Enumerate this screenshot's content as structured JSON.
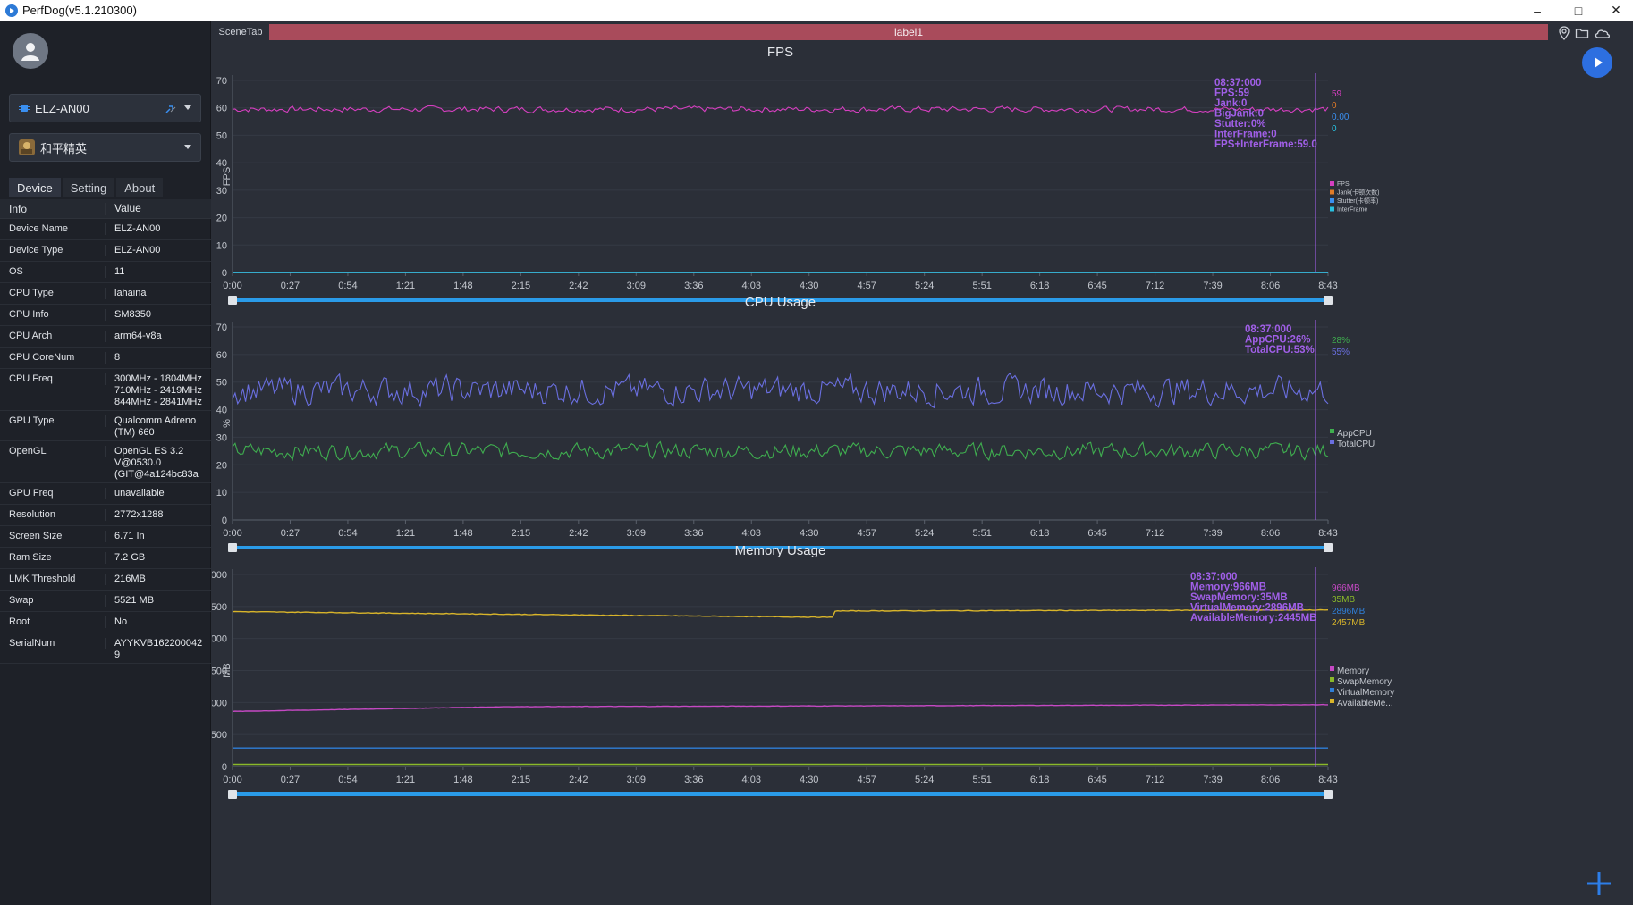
{
  "window": {
    "title": "PerfDog(v5.1.210300)"
  },
  "sidebar": {
    "device_selector": "ELZ-AN00",
    "app_selector": "和平精英",
    "tabs": [
      "Device",
      "Setting",
      "About"
    ],
    "table_headers": {
      "info": "Info",
      "value": "Value"
    },
    "rows": [
      {
        "k": "Device Name",
        "v": "ELZ-AN00"
      },
      {
        "k": "Device Type",
        "v": "ELZ-AN00"
      },
      {
        "k": "OS",
        "v": "11"
      },
      {
        "k": "CPU Type",
        "v": "lahaina"
      },
      {
        "k": "CPU Info",
        "v": "SM8350"
      },
      {
        "k": "CPU Arch",
        "v": "arm64-v8a"
      },
      {
        "k": "CPU CoreNum",
        "v": "8"
      },
      {
        "k": "CPU Freq",
        "v": "300MHz - 1804MHz\n710MHz - 2419MHz\n844MHz - 2841MHz"
      },
      {
        "k": "GPU Type",
        "v": "Qualcomm Adreno\n(TM) 660"
      },
      {
        "k": "OpenGL",
        "v": "OpenGL ES 3.2\nV@0530.0\n(GIT@4a124bc83a"
      },
      {
        "k": "GPU Freq",
        "v": "unavailable"
      },
      {
        "k": "Resolution",
        "v": "2772x1288"
      },
      {
        "k": "Screen Size",
        "v": "6.71 In"
      },
      {
        "k": "Ram Size",
        "v": "7.2 GB"
      },
      {
        "k": "LMK Threshold",
        "v": "216MB"
      },
      {
        "k": "Swap",
        "v": "5521 MB"
      },
      {
        "k": "Root",
        "v": "No"
      },
      {
        "k": "SerialNum",
        "v": "AYYKVB162200042\n9"
      }
    ]
  },
  "scene": {
    "tab": "SceneTab",
    "label": "label1"
  },
  "colors": {
    "fps": "#d63fc0",
    "jank": "#e07b28",
    "stutter": "#3a8ff0",
    "interframe": "#28c0e0",
    "appcpu": "#3fae4f",
    "totalcpu": "#6a6fe0",
    "memory": "#c649c4",
    "swap": "#8ab82a",
    "virtual": "#2f7fd8",
    "available": "#d9b52a",
    "cursor": "#a15fe8",
    "annotation": "#a15fe8",
    "slider": "#2a9be8"
  },
  "chart_data": [
    {
      "type": "line",
      "title": "FPS",
      "ylabel": "FPS",
      "ylim": [
        0,
        70
      ],
      "yticks": [
        "0",
        "10",
        "20",
        "30",
        "40",
        "50",
        "60",
        "70"
      ],
      "xticks": [
        "0:00",
        "0:27",
        "0:54",
        "1:21",
        "1:48",
        "2:15",
        "2:42",
        "3:09",
        "3:36",
        "4:03",
        "4:30",
        "4:57",
        "5:24",
        "5:51",
        "6:18",
        "6:45",
        "7:12",
        "7:39",
        "8:06",
        "8:43"
      ],
      "duration_s": 523,
      "cursor_s": 517,
      "series": [
        {
          "name": "FPS",
          "kind": "noise",
          "base": 59.5,
          "amp": 1.5,
          "color_key": "fps"
        },
        {
          "name": "Jank(卡顿次数)",
          "kind": "flat",
          "base": 0,
          "color_key": "jank"
        },
        {
          "name": "Stutter(卡顿率)",
          "kind": "flat",
          "base": 0,
          "color_key": "stutter"
        },
        {
          "name": "InterFrame",
          "kind": "flat",
          "base": 0,
          "color_key": "interframe"
        }
      ],
      "annotation": [
        "08:37:000",
        "FPS:59",
        "Jank:0",
        "BigJank:0",
        "Stutter:0%",
        "InterFrame:0",
        "FPS+InterFrame:59.0"
      ],
      "right_values": [
        "59",
        "0",
        "0.00",
        "0"
      ]
    },
    {
      "type": "line",
      "title": "CPU Usage",
      "ylabel": "%",
      "ylim": [
        0,
        70
      ],
      "yticks": [
        "0",
        "10",
        "20",
        "30",
        "40",
        "50",
        "60",
        "70"
      ],
      "xticks": [
        "0:00",
        "0:27",
        "0:54",
        "1:21",
        "1:48",
        "2:15",
        "2:42",
        "3:09",
        "3:36",
        "4:03",
        "4:30",
        "4:57",
        "5:24",
        "5:51",
        "6:18",
        "6:45",
        "7:12",
        "7:39",
        "8:06",
        "8:43"
      ],
      "duration_s": 523,
      "cursor_s": 517,
      "series": [
        {
          "name": "AppCPU",
          "kind": "noise",
          "base": 25,
          "amp": 4,
          "color_key": "appcpu"
        },
        {
          "name": "TotalCPU",
          "kind": "noise",
          "base": 47,
          "amp": 7,
          "color_key": "totalcpu"
        }
      ],
      "annotation": [
        "08:37:000",
        "AppCPU:26%",
        "TotalCPU:53%"
      ],
      "right_values": [
        "28%",
        "55%"
      ]
    },
    {
      "type": "line",
      "title": "Memory Usage",
      "ylabel": "MB",
      "ylim": [
        0,
        3000
      ],
      "yticks": [
        "0",
        "500",
        "1,000",
        "1,500",
        "2,000",
        "2,500",
        "3,000"
      ],
      "xticks": [
        "0:00",
        "0:27",
        "0:54",
        "1:21",
        "1:48",
        "2:15",
        "2:42",
        "3:09",
        "3:36",
        "4:03",
        "4:30",
        "4:57",
        "5:24",
        "5:51",
        "6:18",
        "6:45",
        "7:12",
        "7:39",
        "8:06",
        "8:43"
      ],
      "duration_s": 523,
      "cursor_s": 517,
      "series": [
        {
          "name": "Memory",
          "kind": "ramp",
          "from": 860,
          "to": 966,
          "color_key": "memory"
        },
        {
          "name": "SwapMemory",
          "kind": "flat",
          "base": 35,
          "color_key": "swap"
        },
        {
          "name": "VirtualMemory",
          "kind": "flat",
          "base": 290,
          "color_key": "virtual"
        },
        {
          "name": "AvailableMe...",
          "kind": "ramp2",
          "from": 2420,
          "mid": 2330,
          "to": 2445,
          "color_key": "available"
        }
      ],
      "annotation": [
        "08:37:000",
        "Memory:966MB",
        "SwapMemory:35MB",
        "VirtualMemory:2896MB",
        "AvailableMemory:2445MB"
      ],
      "right_values": [
        "966MB",
        "35MB",
        "2896MB",
        "2457MB"
      ]
    }
  ]
}
